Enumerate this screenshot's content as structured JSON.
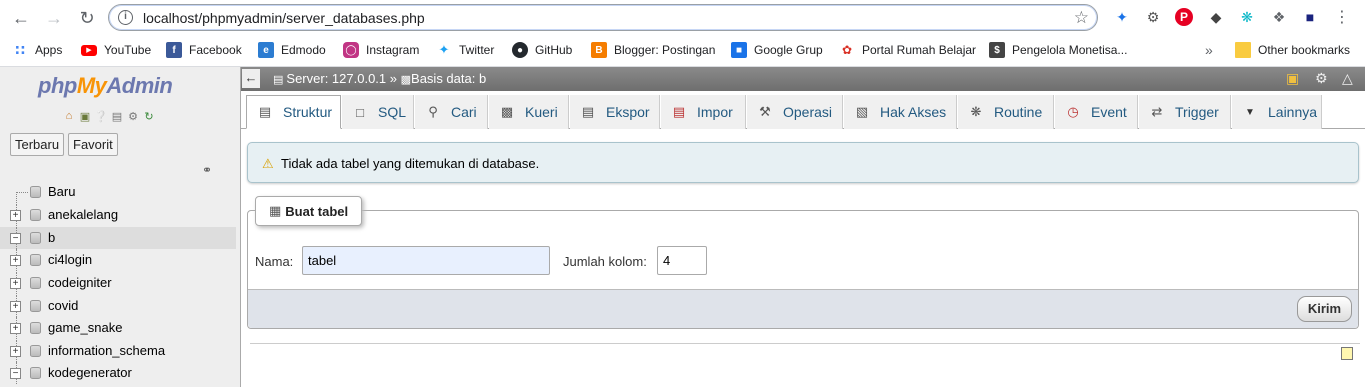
{
  "browser": {
    "url": "localhost/phpmyadmin/server_databases.php",
    "bookmarks": [
      {
        "label": "Apps",
        "icon": "apps-grid-icon",
        "color": "#4285f4"
      },
      {
        "label": "YouTube",
        "icon": "youtube-icon",
        "color": "#ff0000"
      },
      {
        "label": "Facebook",
        "icon": "facebook-icon",
        "color": "#3b5998"
      },
      {
        "label": "Edmodo",
        "icon": "edmodo-icon",
        "color": "#2c7cd1"
      },
      {
        "label": "Instagram",
        "icon": "instagram-icon",
        "color": "#c13584"
      },
      {
        "label": "Twitter",
        "icon": "twitter-icon",
        "color": "#1da1f2"
      },
      {
        "label": "GitHub",
        "icon": "github-icon",
        "color": "#24292e"
      },
      {
        "label": "Blogger: Postingan",
        "icon": "blogger-icon",
        "color": "#f57d00"
      },
      {
        "label": "Google Grup",
        "icon": "google-groups-icon",
        "color": "#1a73e8"
      },
      {
        "label": "Portal Rumah Belajar",
        "icon": "rumah-belajar-icon",
        "color": "#d93025"
      },
      {
        "label": "Pengelola Monetisa...",
        "icon": "adsense-icon",
        "color": "#444444"
      }
    ],
    "other_bookmarks": "Other bookmarks",
    "overflow": "»"
  },
  "nav": {
    "logo": {
      "php": "php",
      "my": "My",
      "admin": "Admin"
    },
    "tabs": {
      "recent": "Terbaru",
      "favorites": "Favorit"
    },
    "new_label": "Baru",
    "databases": [
      {
        "name": "anekalelang",
        "selected": false,
        "expanded": false
      },
      {
        "name": "b",
        "selected": true,
        "expanded": true
      },
      {
        "name": "ci4login",
        "selected": false,
        "expanded": false
      },
      {
        "name": "codeigniter",
        "selected": false,
        "expanded": false
      },
      {
        "name": "covid",
        "selected": false,
        "expanded": false
      },
      {
        "name": "game_snake",
        "selected": false,
        "expanded": false
      },
      {
        "name": "information_schema",
        "selected": false,
        "expanded": false
      },
      {
        "name": "kodegenerator",
        "selected": false,
        "expanded": true
      }
    ]
  },
  "breadcrumb": {
    "server": "Server: 127.0.0.1",
    "sep": "»",
    "database": "Basis data: b"
  },
  "tabs": [
    {
      "label": "Struktur",
      "icon": "structure-icon",
      "active": true
    },
    {
      "label": "SQL",
      "icon": "sql-icon",
      "active": false
    },
    {
      "label": "Cari",
      "icon": "search-icon",
      "active": false
    },
    {
      "label": "Kueri",
      "icon": "query-icon",
      "active": false
    },
    {
      "label": "Ekspor",
      "icon": "export-icon",
      "active": false
    },
    {
      "label": "Impor",
      "icon": "import-icon",
      "active": false
    },
    {
      "label": "Operasi",
      "icon": "wrench-icon",
      "active": false
    },
    {
      "label": "Hak Akses",
      "icon": "privileges-icon",
      "active": false
    },
    {
      "label": "Routine",
      "icon": "routine-icon",
      "active": false
    },
    {
      "label": "Event",
      "icon": "event-clock-icon",
      "active": false
    },
    {
      "label": "Trigger",
      "icon": "trigger-icon",
      "active": false
    },
    {
      "label": "Lainnya",
      "icon": "caret-down-icon",
      "active": false
    }
  ],
  "notice": "Tidak ada tabel yang ditemukan di database.",
  "create_table": {
    "legend": "Buat tabel",
    "name_label": "Nama:",
    "name_value": "tabel",
    "columns_label": "Jumlah kolom:",
    "columns_value": "4",
    "submit": "Kirim"
  }
}
